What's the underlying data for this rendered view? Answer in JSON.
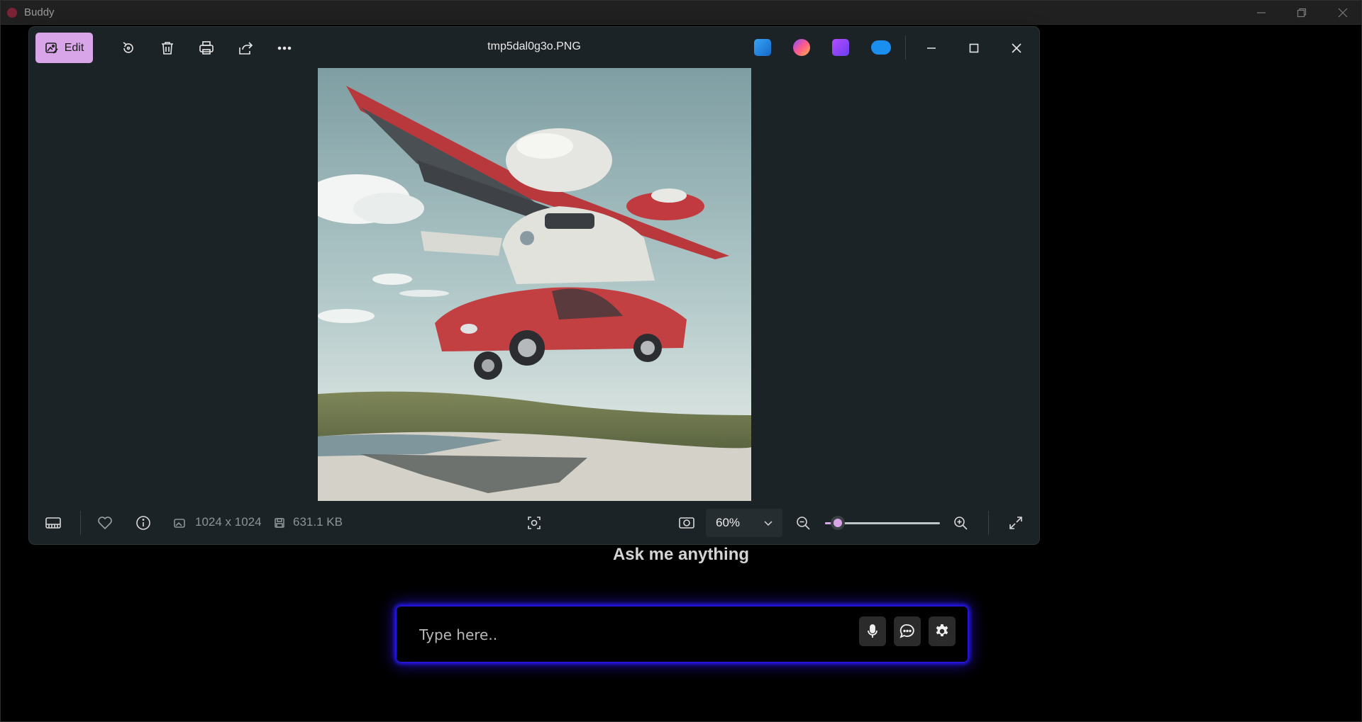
{
  "outer_window": {
    "title": "Buddy",
    "controls": [
      "minimize",
      "restore",
      "close"
    ]
  },
  "photos": {
    "toolbar": {
      "edit_label": "Edit",
      "icons": [
        "rotate-icon",
        "delete-icon",
        "print-icon",
        "share-icon",
        "more-icon"
      ]
    },
    "file_name": "tmp5dal0g3o.PNG",
    "app_icons": [
      "designer-app-icon",
      "copilot-app-icon",
      "clipchamp-app-icon",
      "onedrive-icon"
    ],
    "image_description_visible": false,
    "status": {
      "dimensions": "1024 x 1024",
      "file_size": "631.1 KB",
      "zoom": "60%",
      "zoom_slider_fraction": 0.11
    }
  },
  "assistant": {
    "heading": "Ask me anything",
    "input_placeholder": "Type here..",
    "buttons": [
      "microphone",
      "chat",
      "settings"
    ]
  },
  "colors": {
    "accent": "#d8a6e8",
    "glow": "#2a1aff"
  }
}
